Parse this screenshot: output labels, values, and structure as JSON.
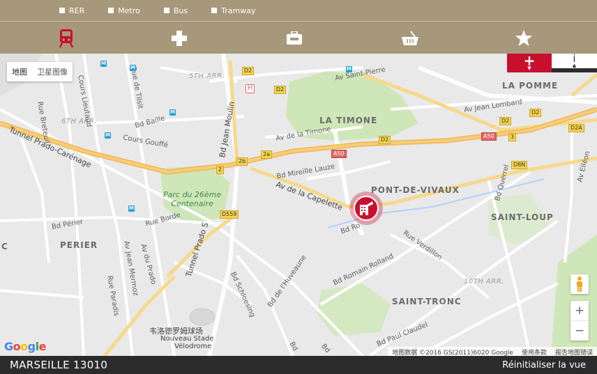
{
  "filters": [
    {
      "label": "RER"
    },
    {
      "label": "Metro"
    },
    {
      "label": "Bus"
    },
    {
      "label": "Tramway"
    }
  ],
  "categories": [
    {
      "icon": "train-icon",
      "color": "#c8102e",
      "active": true
    },
    {
      "icon": "medical-cross-icon",
      "color": "#ffffff"
    },
    {
      "icon": "toolbox-icon",
      "color": "#ffffff"
    },
    {
      "icon": "shopping-basket-icon",
      "color": "#ffffff"
    },
    {
      "icon": "star-icon",
      "color": "#ffffff"
    }
  ],
  "map": {
    "type_buttons": {
      "map": "地图",
      "satellite": "卫星图像"
    },
    "plus_label": "+",
    "info_label": "i",
    "districts": {
      "la_pomme": "LA POMME",
      "la_timone": "LA TIMONE",
      "pont_de_vivaux": "PONT-DE-VIVAUX",
      "saint_loup": "SAINT-LOUP",
      "perier": "PERIER",
      "saint_tronc": "SAINT-TRONC",
      "c": "C"
    },
    "arrondissements": {
      "a5": "5TH ARR.",
      "a6": "6TH ARR.",
      "a10": "10TH ARR."
    },
    "streets": {
      "cours_lieutaud": "Cours Lieutaud",
      "rue_de_tilsit": "Rue de Tilsit",
      "rue_breteuil": "Rue Breteuil",
      "bd_baille": "Bd Baille",
      "cours_gouffe": "Cours Gouffé",
      "tunnel_prado_carenage": "Tunnel Prado-Carénage",
      "bd_jean_moulin": "Bd Jean Moulin",
      "av_de_la_timone": "Av de la Timone",
      "bd_mireille_lauze": "Bd Mireille Lauze",
      "av_de_la_capelette": "Av de la Capelette",
      "av_saint_pierre": "Av Saint-Pierre",
      "av_jean_lombard": "Av Jean Lombard",
      "bd_perier": "Bd Périer",
      "rue_borde": "Rue Borde",
      "tunnel_prado_s": "Tunnel Prado S",
      "av_mermoz": "Av Jean Mermoz",
      "av_du_prado": "Av du Prado",
      "rue_paradis": "Rue Paradis",
      "bd_schloesing": "Bd Schloesing",
      "bd_de_lhuveaune": "Bd de l'Huveaune",
      "bd_romain_rolland": "Bd Romain Rolland",
      "rue_verdillon": "Rue Verdillon",
      "bd_paul_claudel": "Bd Paul Claudel",
      "bd_querrel": "Bd Querrel",
      "av_elleon": "Av Elléon",
      "bd_ro": "Bd Ro",
      "bd_l": "Bd",
      "bd_a": "Bd"
    },
    "parks": {
      "parc_26": "Parc du 26ème\nCentenaire"
    },
    "stadium": {
      "cn": "韦洛德罗姆球场",
      "fr1": "Nouveau Stade",
      "fr2": "Vélodrome"
    },
    "road_badges": {
      "d2_a": "D2",
      "d2_b": "D2",
      "d2_c": "D2",
      "d2_d": "D2",
      "d2_e": "D2",
      "d2a": "D2A",
      "a50_a": "A50",
      "a50_b": "A50",
      "d8n": "D8N",
      "d559": "D559",
      "b2b": "2b",
      "b2a": "2a",
      "b2": "2",
      "b3": "3"
    },
    "hospital": "H",
    "metro_letter": "M",
    "google_logo": {
      "G": "G",
      "o1": "o",
      "o2": "o",
      "g": "g",
      "l": "l",
      "e": "e"
    },
    "attribution": {
      "data": "地图数据 ©2016 GS(2011)6020 Google",
      "terms": "使用条款",
      "report": "报告地图错误"
    },
    "zoom_in": "+",
    "zoom_out": "−",
    "colors": {
      "brand_red": "#c8102e",
      "bar_tan": "#a7987c",
      "highway": "#f7c86d"
    }
  },
  "footer": {
    "city": "MARSEILLE 13010",
    "reset": "Réinitialiser la vue"
  }
}
